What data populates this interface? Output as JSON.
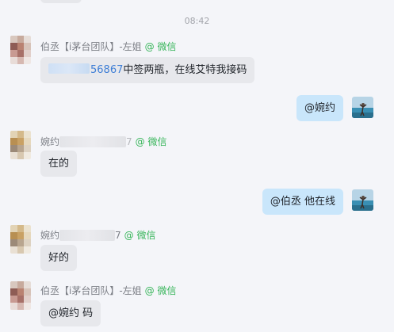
{
  "time_divider": "08:42",
  "colors": {
    "accent_wechat": "#37b55a",
    "bubble_self": "#c9e6fb",
    "bubble_other": "#e7e8ec"
  },
  "messages": [
    {
      "sender": {
        "name_prefix": "伯丞【i茅台团队】-左姐",
        "source": "@ 微信"
      },
      "text_number_visible": "56867",
      "text_rest": "中签两瓶，在线艾特我接码",
      "side": "left"
    },
    {
      "text": "@婉约",
      "side": "right"
    },
    {
      "sender": {
        "name_prefix": "婉约",
        "name_suffix": "7",
        "source": "@ 微信"
      },
      "text": "在的",
      "side": "left"
    },
    {
      "text": "@伯丞 他在线",
      "side": "right"
    },
    {
      "sender": {
        "name_prefix": "婉约",
        "name_suffix": "7",
        "source": "@ 微信"
      },
      "text": "好的",
      "side": "left"
    },
    {
      "sender": {
        "name_prefix": "伯丞【i茅台团队】-左姐",
        "source": "@ 微信"
      },
      "text": "@婉约 码",
      "side": "left"
    }
  ],
  "icons": {
    "avatar_other": "pixelated-avatar",
    "avatar_self": "beach-photo-avatar"
  }
}
